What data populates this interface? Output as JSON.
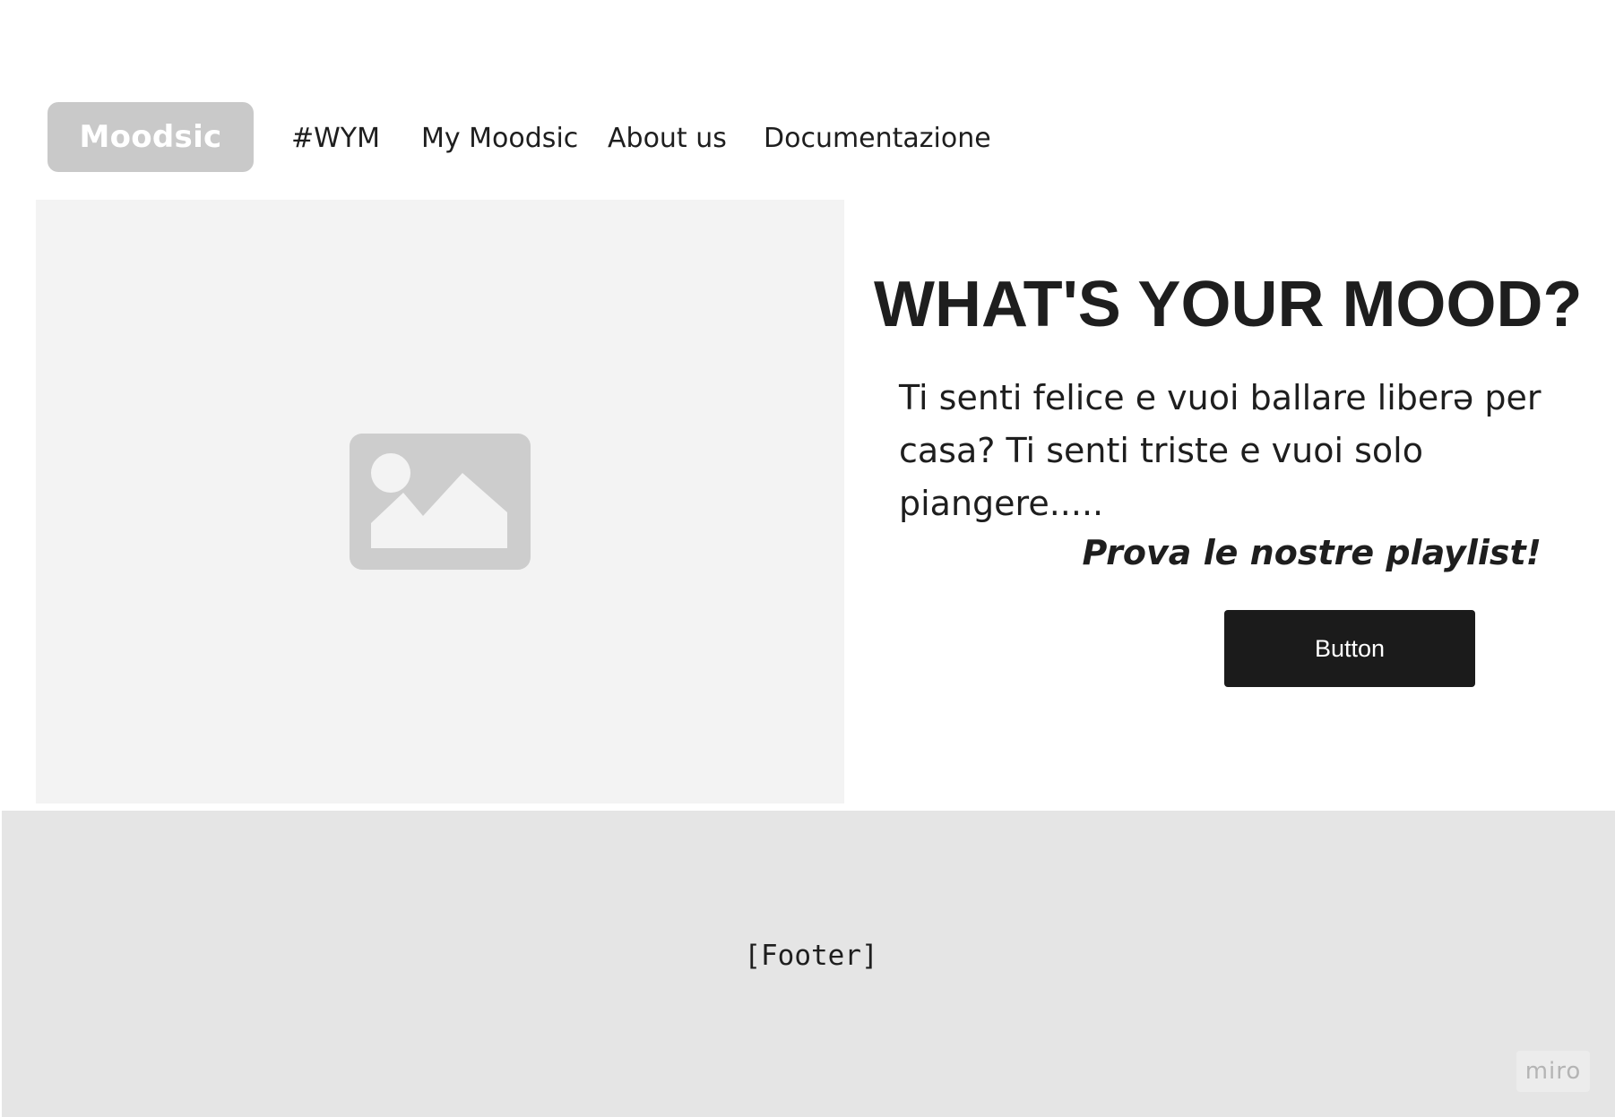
{
  "nav": {
    "logo_label": "Moodsic",
    "links": [
      {
        "label": "#WYM"
      },
      {
        "label": "My Moodsic"
      },
      {
        "label": "About us"
      },
      {
        "label": "Documentazione"
      }
    ]
  },
  "hero": {
    "image_icon": "image-placeholder-icon",
    "headline": "WHAT'S YOUR MOOD?",
    "intro": "Ti senti felice e vuoi ballare liberə per casa? Ti senti triste e vuoi solo piangere.....",
    "cta_text": "Prova le nostre playlist!",
    "button_label": "Button"
  },
  "footer": {
    "label": "[Footer]"
  },
  "watermark": {
    "label": "miro"
  },
  "colors": {
    "logo_bg": "#c9c9c9",
    "text": "#1e1e1e",
    "image_bg": "#f3f3f3",
    "button_bg": "#1b1b1b",
    "footer_bg": "#e5e5e5"
  }
}
